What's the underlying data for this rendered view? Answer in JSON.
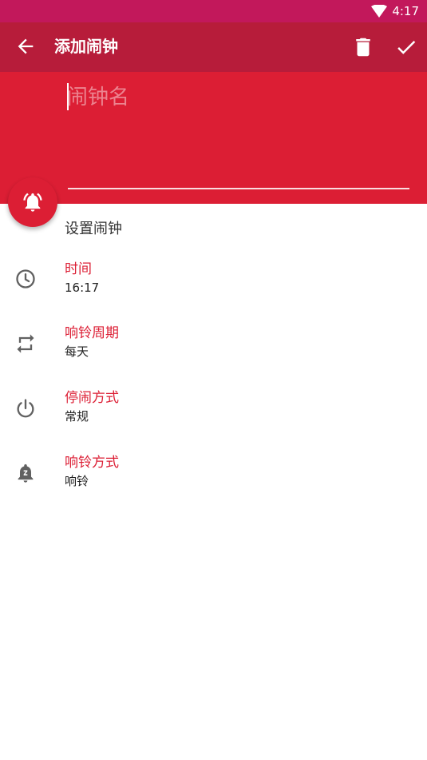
{
  "status_bar": {
    "time": "4:17"
  },
  "app_bar": {
    "title": "添加闹钟"
  },
  "name_field": {
    "placeholder": "闹钟名",
    "value": ""
  },
  "section": {
    "title": "设置闹钟"
  },
  "settings": [
    {
      "label": "时间",
      "value": "16:17",
      "icon": "clock-icon"
    },
    {
      "label": "响铃周期",
      "value": "每天",
      "icon": "repeat-icon"
    },
    {
      "label": "停闹方式",
      "value": "常规",
      "icon": "power-icon"
    },
    {
      "label": "响铃方式",
      "value": "响铃",
      "icon": "bell-snooze-icon"
    }
  ],
  "colors": {
    "accent": "#dc1e34",
    "app_bar": "#b71c3a",
    "status_bar": "#c2185b"
  }
}
